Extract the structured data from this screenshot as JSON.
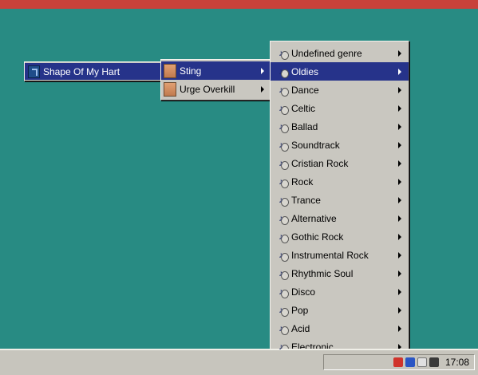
{
  "menus": {
    "level1": {
      "items": [
        {
          "label": "Shape Of My Hart",
          "active": true
        }
      ]
    },
    "level2": {
      "items": [
        {
          "label": "Sting",
          "active": true,
          "has_submenu": true
        },
        {
          "label": "Urge Overkill",
          "active": false,
          "has_submenu": true
        }
      ]
    },
    "level3": {
      "items": [
        {
          "label": "Undefined genre"
        },
        {
          "label": "Oldies",
          "active": true
        },
        {
          "label": "Dance"
        },
        {
          "label": "Celtic"
        },
        {
          "label": "Ballad"
        },
        {
          "label": "Soundtrack"
        },
        {
          "label": "Cristian Rock"
        },
        {
          "label": "Rock"
        },
        {
          "label": "Trance"
        },
        {
          "label": "Alternative"
        },
        {
          "label": "Gothic Rock"
        },
        {
          "label": "Instrumental Rock"
        },
        {
          "label": "Rhythmic Soul"
        },
        {
          "label": "Disco"
        },
        {
          "label": "Pop"
        },
        {
          "label": "Acid"
        },
        {
          "label": "Electronic"
        }
      ]
    }
  },
  "taskbar": {
    "clock": "17:08",
    "tray_icon_colors": [
      "#d0342c",
      "#2b56c4",
      "#e0e0e0",
      "#3a3a3a"
    ]
  },
  "colors": {
    "desktop": "#288b83",
    "highlight": "#26338a",
    "menu_bg": "#c9c7c0"
  }
}
